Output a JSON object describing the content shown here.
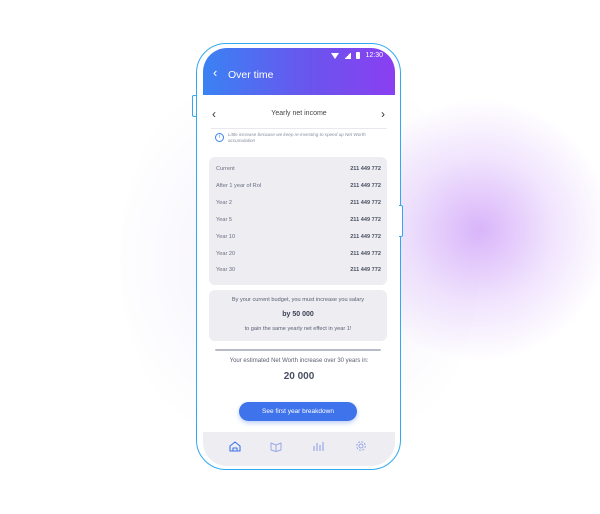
{
  "status_bar": {
    "time": "12:30"
  },
  "header": {
    "title": "Over time"
  },
  "section": {
    "title": "Yearly net income"
  },
  "info": {
    "text": "Little increase because we keep re-investing to speed up Net Worth accumulation"
  },
  "rows": [
    {
      "label": "Current",
      "value": "211 449 772"
    },
    {
      "label": "After 1 year of RoI",
      "value": "211 449 772"
    },
    {
      "label": "Year 2",
      "value": "211 449 772"
    },
    {
      "label": "Year 5",
      "value": "211 449 772"
    },
    {
      "label": "Year 10",
      "value": "211 449 772"
    },
    {
      "label": "Year 20",
      "value": "211 449 772"
    },
    {
      "label": "Year 30",
      "value": "211 449 772"
    }
  ],
  "budget": {
    "line1": "By your current budget, you must increase you salary",
    "amount": "by 50 000",
    "line3": "to gain the same yearly net effect in year 1!"
  },
  "net_worth": {
    "label": "Your estimated Net Worth increase over 30 years in:",
    "value": "20 000"
  },
  "cta": {
    "label": "See first year breakdown"
  },
  "tabs": [
    {
      "icon": "home-icon"
    },
    {
      "icon": "wallet-icon"
    },
    {
      "icon": "bar-chart-icon"
    },
    {
      "icon": "gear-icon"
    }
  ],
  "colors": {
    "accent": "#3f73ec",
    "gradient_start": "#3a82f3",
    "gradient_end": "#8a3ff0",
    "frame": "#31a9f2"
  }
}
